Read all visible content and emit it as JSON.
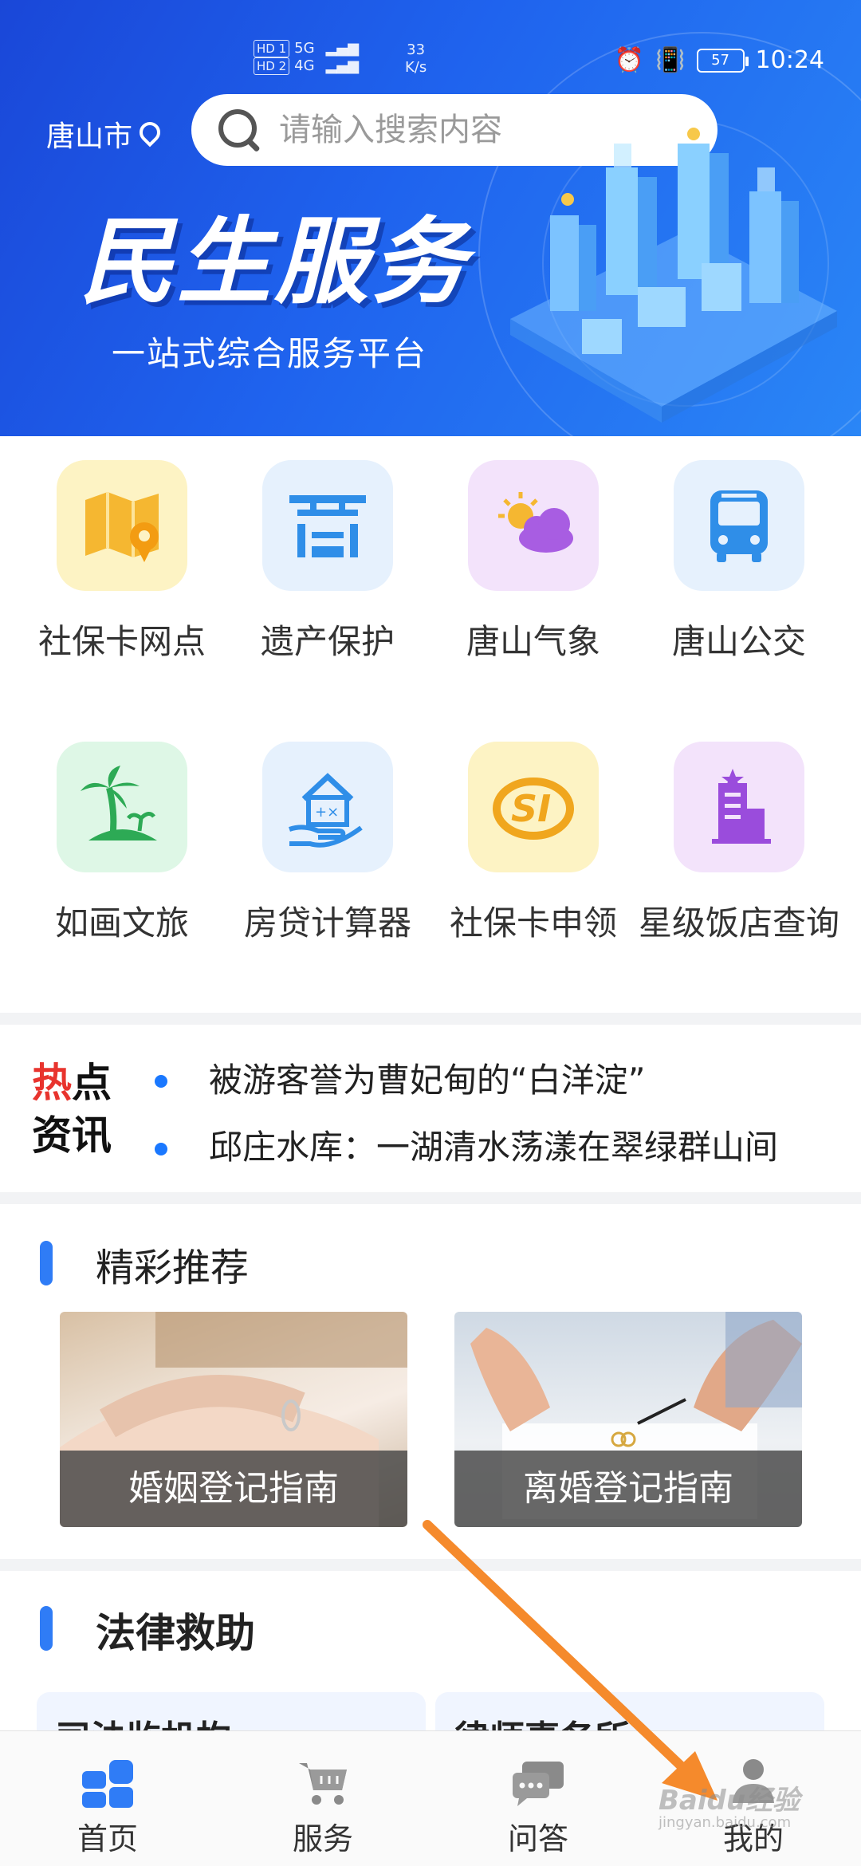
{
  "status_bar": {
    "hd1": "HD 1",
    "hd2": "HD 2",
    "sig1": "5G",
    "sig2": "4G",
    "speed_value": "33",
    "speed_unit": "K/s",
    "battery": "57",
    "time": "10:24"
  },
  "header": {
    "city": "唐山市",
    "search_placeholder": "请输入搜索内容",
    "banner_title": "民生服务",
    "banner_subtitle": "一站式综合服务平台"
  },
  "services": [
    {
      "label": "社保卡网点",
      "icon": "map-pin-icon",
      "bg": "#fdf3c4",
      "fg": "#f5b731"
    },
    {
      "label": "遗产保护",
      "icon": "heritage-icon",
      "bg": "#e6f1fd",
      "fg": "#2f8ee8"
    },
    {
      "label": "唐山气象",
      "icon": "weather-icon",
      "bg": "#f3e3fb",
      "fg": "#a85de2"
    },
    {
      "label": "唐山公交",
      "icon": "bus-icon",
      "bg": "#e6f1fd",
      "fg": "#2f8ee8"
    },
    {
      "label": "如画文旅",
      "icon": "palm-tree-icon",
      "bg": "#def7e6",
      "fg": "#2daa55"
    },
    {
      "label": "房贷计算器",
      "icon": "house-calculator-icon",
      "bg": "#e6f1fd",
      "fg": "#2f8ee8"
    },
    {
      "label": "社保卡申领",
      "icon": "social-security-icon",
      "bg": "#fdf3c4",
      "fg": "#f0a61e"
    },
    {
      "label": "星级饭店查询",
      "icon": "hotel-icon",
      "bg": "#f3e3fb",
      "fg": "#9a4cdc"
    }
  ],
  "news": {
    "badge_hot": "热",
    "badge_point": "点",
    "badge_info": "资讯",
    "items": [
      "被游客誉为曹妃甸的“白洋淀”",
      "邱庄水库：一湖清水荡漾在翠绿群山间"
    ]
  },
  "recommend": {
    "title": "精彩推荐",
    "cards": [
      "婚姻登记指南",
      "离婚登记指南"
    ]
  },
  "legal": {
    "title": "法律救助",
    "cards": [
      "司法监机构",
      "律师事务所"
    ]
  },
  "tabs": [
    {
      "label": "首页",
      "icon": "home-grid-icon",
      "active": true
    },
    {
      "label": "服务",
      "icon": "cart-icon",
      "active": false
    },
    {
      "label": "问答",
      "icon": "chat-icon",
      "active": false
    },
    {
      "label": "我的",
      "icon": "user-icon",
      "active": false
    }
  ],
  "watermark": {
    "brand": "Baidu经验",
    "url": "jingyan.baidu.com"
  },
  "colors": {
    "accent": "#2f7cf6",
    "hot": "#e8342e",
    "arrow": "#f58a2c",
    "banner": "#1f5fe9"
  }
}
